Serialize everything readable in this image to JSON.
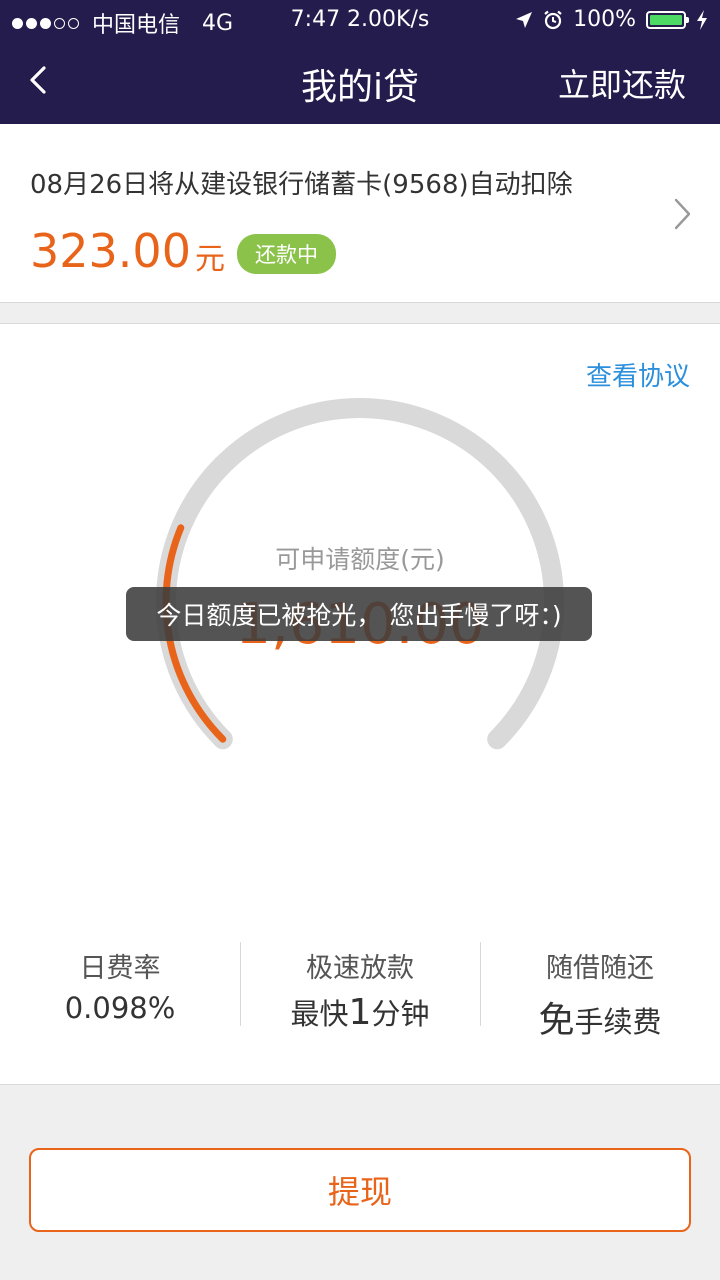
{
  "status_bar": {
    "carrier": "中国电信",
    "network": "4G",
    "time_speed": "7:47 2.00K/s",
    "battery_text": "100%",
    "battery_level": 1.0,
    "signal_bars_filled": 3,
    "signal_bars_total": 5
  },
  "nav": {
    "title": "我的i贷",
    "repay_now": "立即还款"
  },
  "repayment": {
    "deduct_text": "08月26日将从建设银行储蓄卡(9568)自动扣除",
    "amount": "323.00",
    "unit": "元",
    "status_badge": "还款中"
  },
  "credit": {
    "view_agreement": "查看协议",
    "limit_label": "可申请额度(元)",
    "limit_value": "1,610.00",
    "progress_fraction": 0.25
  },
  "toast": {
    "message": "今日额度已被抢光， 您出手慢了呀：)"
  },
  "features": [
    {
      "title": "日费率",
      "value_big": "",
      "value_rest": "0.098%"
    },
    {
      "title": "极速放款",
      "value_pre": "最快",
      "value_big": "1",
      "value_rest": "分钟"
    },
    {
      "title": "随借随还",
      "value_pre": "",
      "value_big": "免",
      "value_rest": "手续费"
    }
  ],
  "withdraw": {
    "label": "提现"
  },
  "colors": {
    "nav_bg": "#231c4d",
    "accent_orange": "#e8641b",
    "badge_green": "#8bc24a",
    "link_blue": "#2b8fdc",
    "track_gray": "#d9d9d9"
  }
}
